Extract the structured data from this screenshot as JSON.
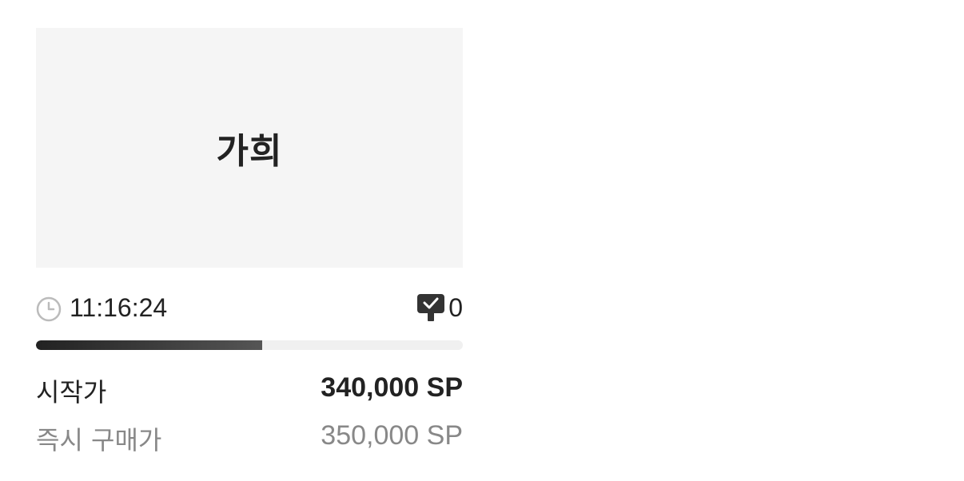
{
  "item": {
    "title": "가희",
    "time_remaining": "11:16:24",
    "bid_count": "0",
    "progress_percent": 53
  },
  "prices": {
    "start_label": "시작가",
    "start_value": "340,000 SP",
    "buy_now_label": "즉시 구매가",
    "buy_now_value": "350,000 SP"
  },
  "icons": {
    "timer": "clock-icon",
    "bids": "gavel-icon"
  },
  "colors": {
    "thumbnail_bg": "#f5f5f5",
    "progress_fill": "#222222",
    "progress_track": "#f0f0f0",
    "muted_text": "#888888"
  }
}
